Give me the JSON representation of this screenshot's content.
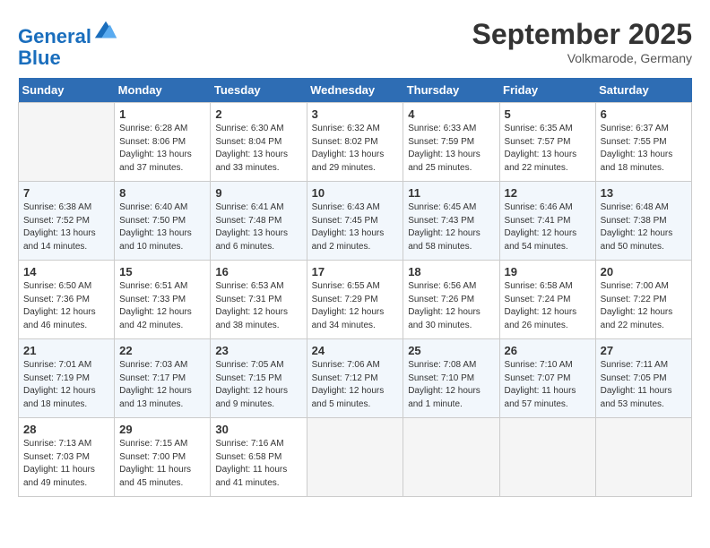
{
  "header": {
    "logo_line1": "General",
    "logo_line2": "Blue",
    "month": "September 2025",
    "location": "Volkmarode, Germany"
  },
  "weekdays": [
    "Sunday",
    "Monday",
    "Tuesday",
    "Wednesday",
    "Thursday",
    "Friday",
    "Saturday"
  ],
  "weeks": [
    [
      {
        "day": "",
        "info": ""
      },
      {
        "day": "1",
        "info": "Sunrise: 6:28 AM\nSunset: 8:06 PM\nDaylight: 13 hours\nand 37 minutes."
      },
      {
        "day": "2",
        "info": "Sunrise: 6:30 AM\nSunset: 8:04 PM\nDaylight: 13 hours\nand 33 minutes."
      },
      {
        "day": "3",
        "info": "Sunrise: 6:32 AM\nSunset: 8:02 PM\nDaylight: 13 hours\nand 29 minutes."
      },
      {
        "day": "4",
        "info": "Sunrise: 6:33 AM\nSunset: 7:59 PM\nDaylight: 13 hours\nand 25 minutes."
      },
      {
        "day": "5",
        "info": "Sunrise: 6:35 AM\nSunset: 7:57 PM\nDaylight: 13 hours\nand 22 minutes."
      },
      {
        "day": "6",
        "info": "Sunrise: 6:37 AM\nSunset: 7:55 PM\nDaylight: 13 hours\nand 18 minutes."
      }
    ],
    [
      {
        "day": "7",
        "info": "Sunrise: 6:38 AM\nSunset: 7:52 PM\nDaylight: 13 hours\nand 14 minutes."
      },
      {
        "day": "8",
        "info": "Sunrise: 6:40 AM\nSunset: 7:50 PM\nDaylight: 13 hours\nand 10 minutes."
      },
      {
        "day": "9",
        "info": "Sunrise: 6:41 AM\nSunset: 7:48 PM\nDaylight: 13 hours\nand 6 minutes."
      },
      {
        "day": "10",
        "info": "Sunrise: 6:43 AM\nSunset: 7:45 PM\nDaylight: 13 hours\nand 2 minutes."
      },
      {
        "day": "11",
        "info": "Sunrise: 6:45 AM\nSunset: 7:43 PM\nDaylight: 12 hours\nand 58 minutes."
      },
      {
        "day": "12",
        "info": "Sunrise: 6:46 AM\nSunset: 7:41 PM\nDaylight: 12 hours\nand 54 minutes."
      },
      {
        "day": "13",
        "info": "Sunrise: 6:48 AM\nSunset: 7:38 PM\nDaylight: 12 hours\nand 50 minutes."
      }
    ],
    [
      {
        "day": "14",
        "info": "Sunrise: 6:50 AM\nSunset: 7:36 PM\nDaylight: 12 hours\nand 46 minutes."
      },
      {
        "day": "15",
        "info": "Sunrise: 6:51 AM\nSunset: 7:33 PM\nDaylight: 12 hours\nand 42 minutes."
      },
      {
        "day": "16",
        "info": "Sunrise: 6:53 AM\nSunset: 7:31 PM\nDaylight: 12 hours\nand 38 minutes."
      },
      {
        "day": "17",
        "info": "Sunrise: 6:55 AM\nSunset: 7:29 PM\nDaylight: 12 hours\nand 34 minutes."
      },
      {
        "day": "18",
        "info": "Sunrise: 6:56 AM\nSunset: 7:26 PM\nDaylight: 12 hours\nand 30 minutes."
      },
      {
        "day": "19",
        "info": "Sunrise: 6:58 AM\nSunset: 7:24 PM\nDaylight: 12 hours\nand 26 minutes."
      },
      {
        "day": "20",
        "info": "Sunrise: 7:00 AM\nSunset: 7:22 PM\nDaylight: 12 hours\nand 22 minutes."
      }
    ],
    [
      {
        "day": "21",
        "info": "Sunrise: 7:01 AM\nSunset: 7:19 PM\nDaylight: 12 hours\nand 18 minutes."
      },
      {
        "day": "22",
        "info": "Sunrise: 7:03 AM\nSunset: 7:17 PM\nDaylight: 12 hours\nand 13 minutes."
      },
      {
        "day": "23",
        "info": "Sunrise: 7:05 AM\nSunset: 7:15 PM\nDaylight: 12 hours\nand 9 minutes."
      },
      {
        "day": "24",
        "info": "Sunrise: 7:06 AM\nSunset: 7:12 PM\nDaylight: 12 hours\nand 5 minutes."
      },
      {
        "day": "25",
        "info": "Sunrise: 7:08 AM\nSunset: 7:10 PM\nDaylight: 12 hours\nand 1 minute."
      },
      {
        "day": "26",
        "info": "Sunrise: 7:10 AM\nSunset: 7:07 PM\nDaylight: 11 hours\nand 57 minutes."
      },
      {
        "day": "27",
        "info": "Sunrise: 7:11 AM\nSunset: 7:05 PM\nDaylight: 11 hours\nand 53 minutes."
      }
    ],
    [
      {
        "day": "28",
        "info": "Sunrise: 7:13 AM\nSunset: 7:03 PM\nDaylight: 11 hours\nand 49 minutes."
      },
      {
        "day": "29",
        "info": "Sunrise: 7:15 AM\nSunset: 7:00 PM\nDaylight: 11 hours\nand 45 minutes."
      },
      {
        "day": "30",
        "info": "Sunrise: 7:16 AM\nSunset: 6:58 PM\nDaylight: 11 hours\nand 41 minutes."
      },
      {
        "day": "",
        "info": ""
      },
      {
        "day": "",
        "info": ""
      },
      {
        "day": "",
        "info": ""
      },
      {
        "day": "",
        "info": ""
      }
    ]
  ]
}
